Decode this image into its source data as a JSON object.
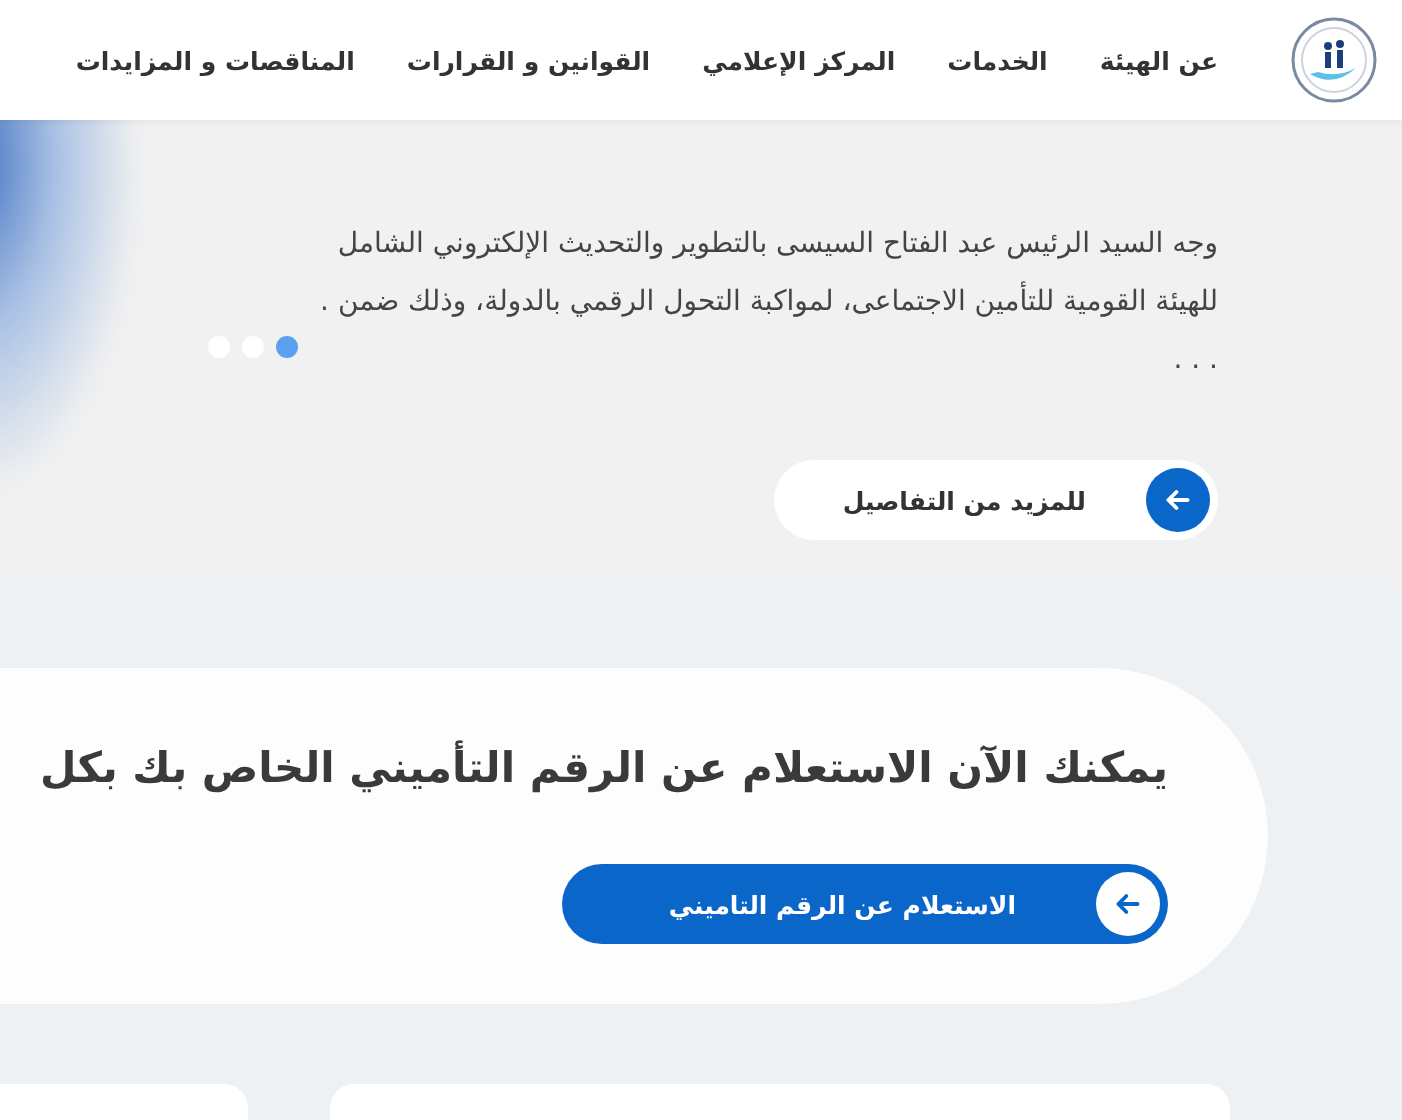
{
  "header": {
    "nav": [
      {
        "label": "عن الهيئة"
      },
      {
        "label": "الخدمات"
      },
      {
        "label": "المركز الإعلامي"
      },
      {
        "label": "القوانين و القرارات"
      },
      {
        "label": "المناقصات و المزايدات"
      }
    ]
  },
  "hero": {
    "text": "وجه السيد الرئيس عبد الفتاح السيسى بالتطوير والتحديث الإلكتروني الشامل للهيئة القومية للتأمين الاجتماعى، لمواكبة التحول الرقمي بالدولة، وذلك ضمن . . . .",
    "slides": [
      {
        "selected": true
      },
      {
        "selected": false
      },
      {
        "selected": false
      }
    ],
    "button": "للمزيد من التفاصيل"
  },
  "inquiry": {
    "heading": "يمكنك الآن الاستعلام عن الرقم التأميني الخاص بك بكل",
    "button": "الاستعلام عن الرقم التاميني"
  }
}
